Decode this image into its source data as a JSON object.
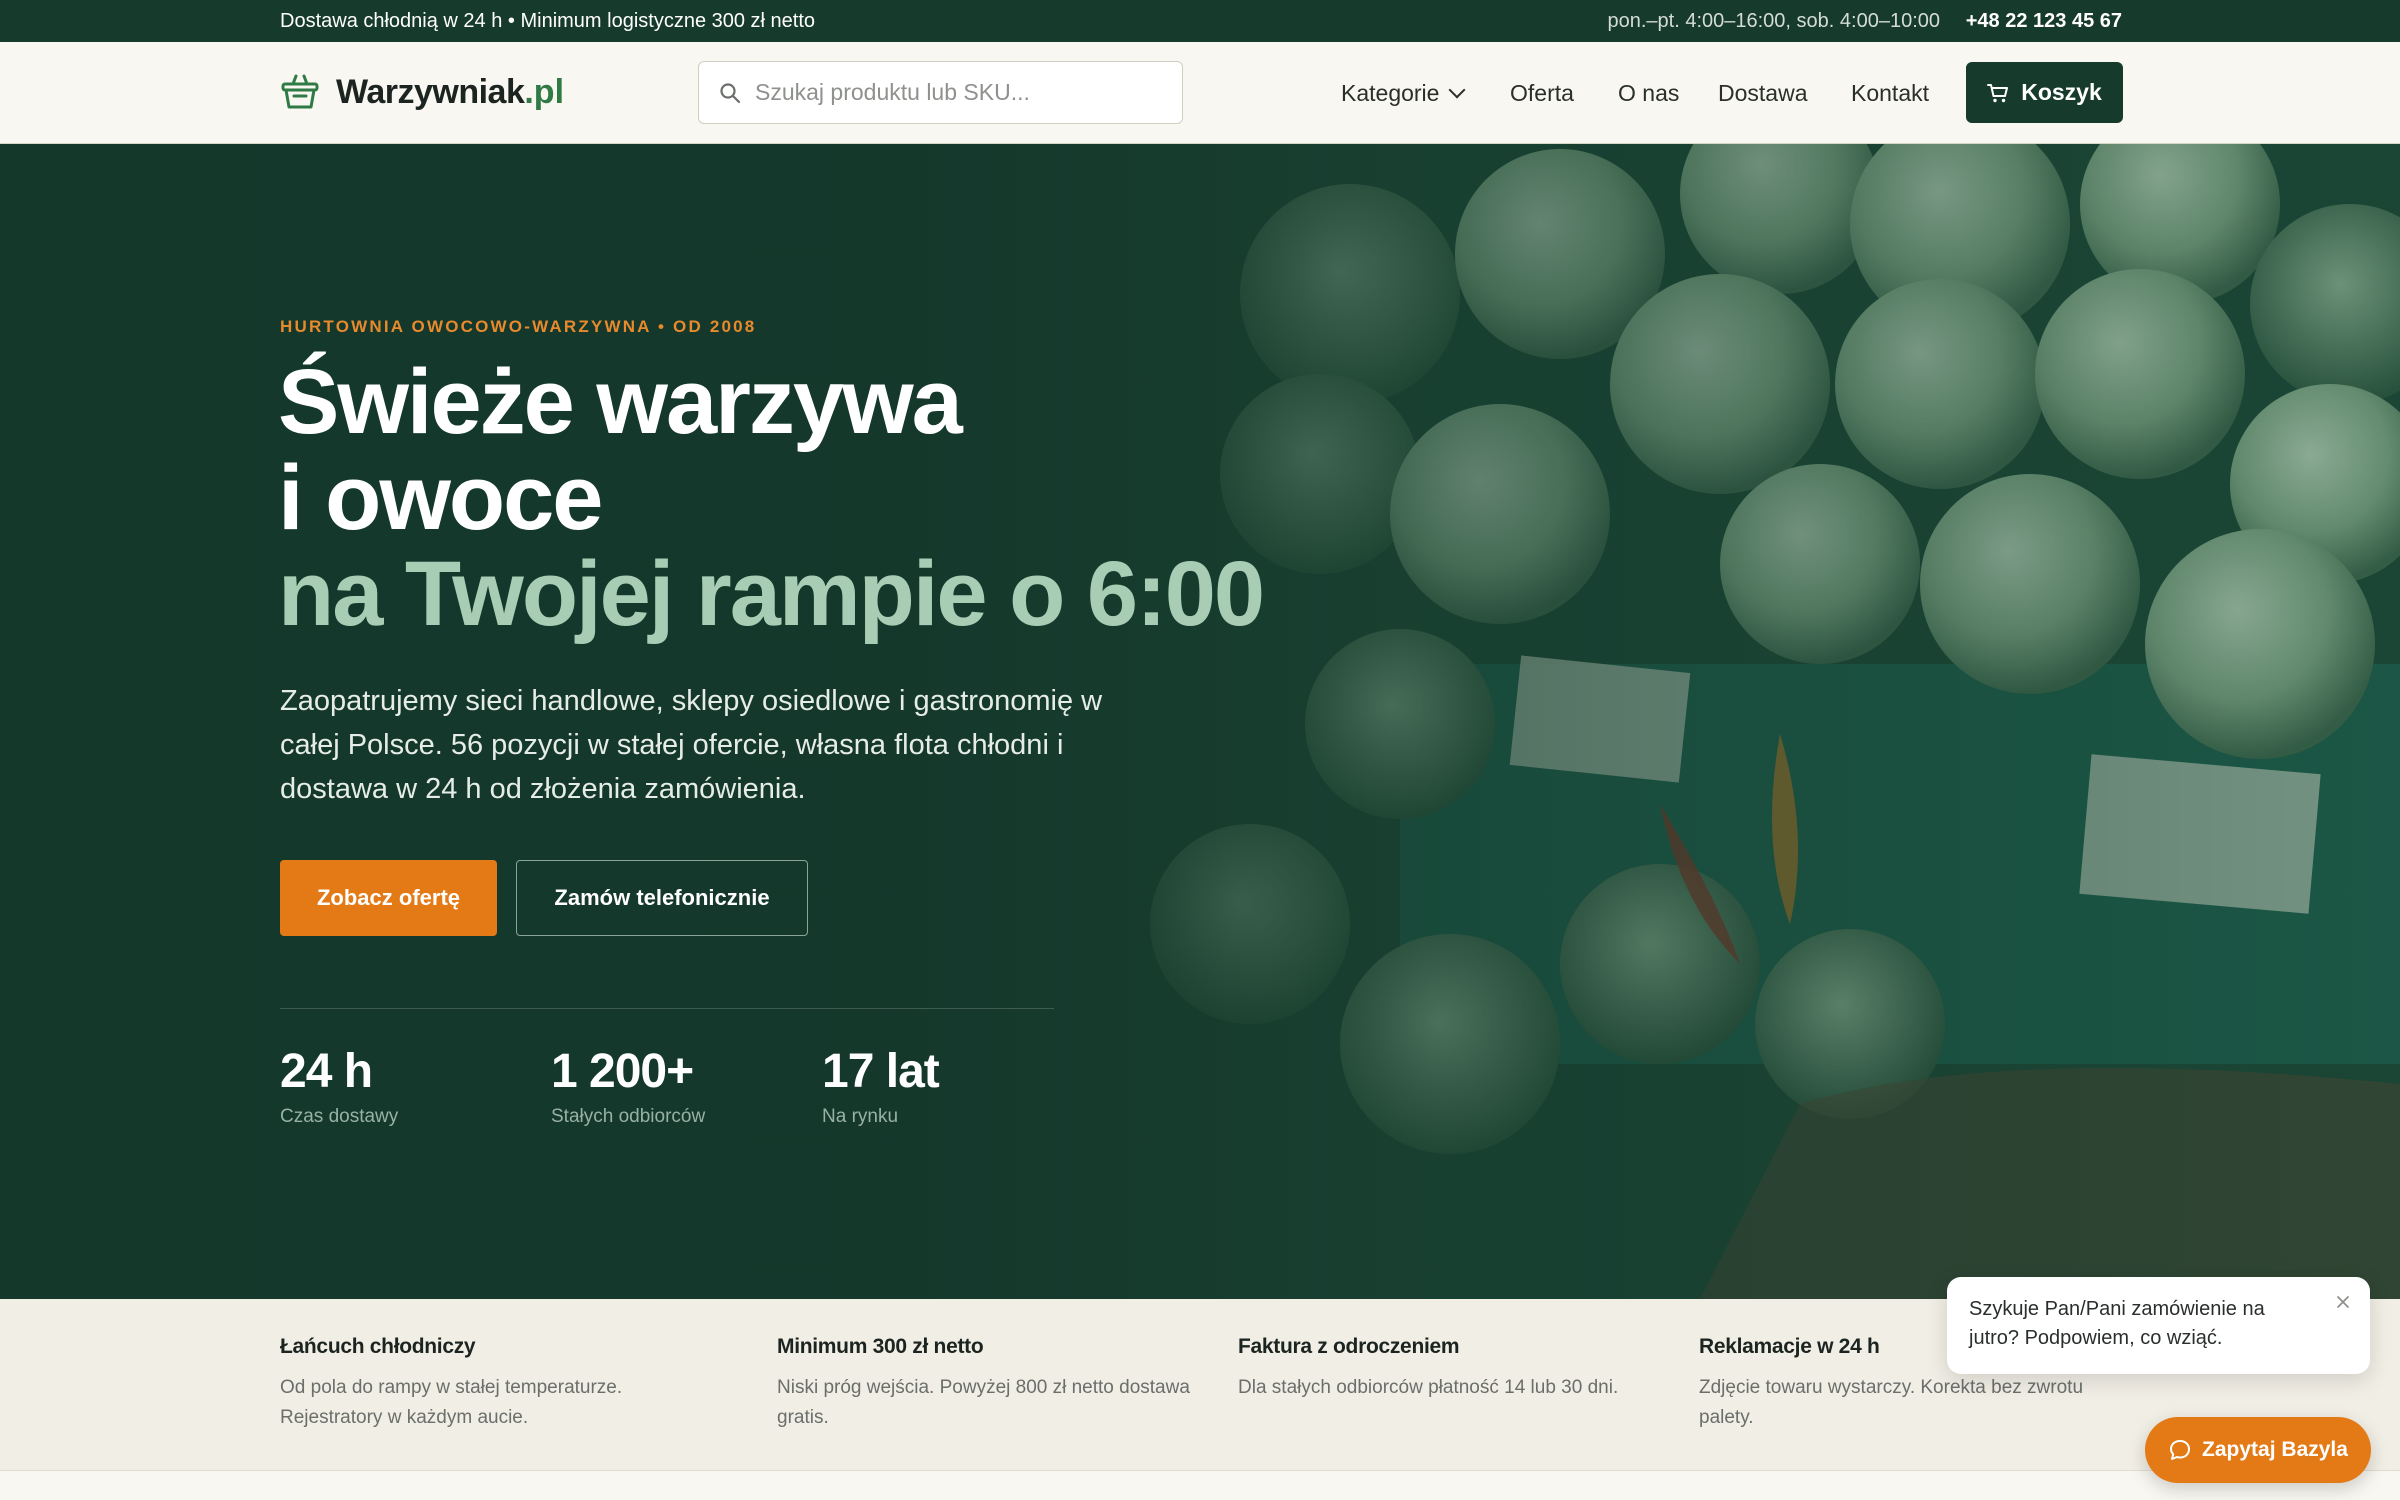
{
  "topbar": {
    "info": "Dostawa chłodnią w 24 h • Minimum logistyczne 300 zł netto",
    "hours": "pon.–pt. 4:00–16:00, sob. 4:00–10:00",
    "phone": "+48 22 123 45 67"
  },
  "header": {
    "logo_name": "Warzywniak",
    "logo_tld": ".pl",
    "logo_icon": "basket-icon",
    "search_placeholder": "Szukaj produktu lub SKU...",
    "nav": {
      "categories": "Kategorie",
      "offer": "Oferta",
      "about": "O nas",
      "delivery": "Dostawa",
      "contact": "Kontakt"
    },
    "cart_label": "Koszyk"
  },
  "hero": {
    "eyebrow": "HURTOWNIA OWOCOWO-WARZYWNA • OD 2008",
    "title_line1": "Świeże warzywa",
    "title_line2": "i owoce",
    "title_line3": "na Twojej rampie o 6:00",
    "lead": "Zaopatrujemy sieci handlowe, sklepy osiedlowe i gastronomię w całej Polsce. 56 pozycji w stałej ofercie, własna flota chłodni i dostawa w 24 h od złożenia zamówienia.",
    "cta_primary": "Zobacz ofertę",
    "cta_secondary": "Zamów telefonicznie",
    "stats": [
      {
        "value": "24 h",
        "label": "Czas dostawy"
      },
      {
        "value": "1 200+",
        "label": "Stałych odbiorców"
      },
      {
        "value": "17 lat",
        "label": "Na rynku"
      }
    ]
  },
  "features": [
    {
      "title": "Łańcuch chłodniczy",
      "desc": "Od pola do rampy w stałej temperaturze. Rejestratory w każdym aucie."
    },
    {
      "title": "Minimum 300 zł netto",
      "desc": "Niski próg wejścia. Powyżej 800 zł netto dostawa gratis."
    },
    {
      "title": "Faktura z odroczeniem",
      "desc": "Dla stałych odbiorców płatność 14 lub 30 dni."
    },
    {
      "title": "Reklamacje w 24 h",
      "desc": "Zdjęcie towaru wystarczy. Korekta bez zwrotu palety."
    }
  ],
  "chat": {
    "message": "Szykuje Pan/Pani zamówienie na jutro? Podpowiem, co wziąć.",
    "button_label": "Zapytaj Bazyla"
  },
  "colors": {
    "brand_dark": "#163a2c",
    "accent_orange": "#e37a16",
    "accent_green_light": "#a9cdb4",
    "logo_green": "#2f7a45"
  }
}
